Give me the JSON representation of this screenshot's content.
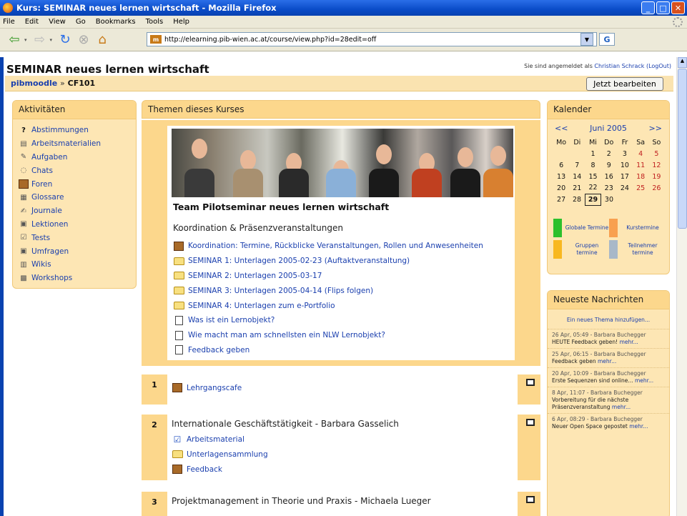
{
  "window": {
    "title": "Kurs: SEMINAR neues lernen wirtschaft - Mozilla Firefox",
    "menu": [
      "File",
      "Edit",
      "View",
      "Go",
      "Bookmarks",
      "Tools",
      "Help"
    ],
    "url": "http://elearning.pib-wien.ac.at/course/view.php?id=28edit=off"
  },
  "page": {
    "course_title": "SEMINAR neues lernen wirtschaft",
    "login_prefix": "Sie sind angemeldet als",
    "login_user": "Christian Schrack",
    "logout": "(LogOut)",
    "breadcrumb_home": "pibmoodle",
    "breadcrumb_sep": "»",
    "breadcrumb_course": "CF101",
    "edit_button": "Jetzt bearbeiten"
  },
  "activities": {
    "header": "Aktivitäten",
    "items": [
      {
        "label": "Abstimmungen",
        "icon": "question-icon"
      },
      {
        "label": "Arbeitsmaterialien",
        "icon": "document-icon"
      },
      {
        "label": "Aufgaben",
        "icon": "assignment-icon"
      },
      {
        "label": "Chats",
        "icon": "chat-icon"
      },
      {
        "label": "Foren",
        "icon": "forum-icon"
      },
      {
        "label": "Glossare",
        "icon": "glossary-icon"
      },
      {
        "label": "Journale",
        "icon": "journal-icon"
      },
      {
        "label": "Lektionen",
        "icon": "lesson-icon"
      },
      {
        "label": "Tests",
        "icon": "quiz-icon"
      },
      {
        "label": "Umfragen",
        "icon": "survey-icon"
      },
      {
        "label": "Wikis",
        "icon": "wiki-icon"
      },
      {
        "label": "Workshops",
        "icon": "workshop-icon"
      }
    ]
  },
  "main": {
    "header": "Themen dieses Kurses",
    "team_title": "Team Pilotseminar neues lernen wirtschaft",
    "section0_subtitle": "Koordination & Präsenzveranstaltungen",
    "section0_items": [
      {
        "label": "Koordination: Termine, Rückblicke Veranstaltungen, Rollen und Anwesenheiten",
        "icon": "forum-icon"
      },
      {
        "label": "SEMINAR 1: Unterlagen 2005-02-23 (Auftaktveranstaltung)",
        "icon": "folder-icon"
      },
      {
        "label": "SEMINAR 2: Unterlagen 2005-03-17",
        "icon": "folder-icon"
      },
      {
        "label": "SEMINAR 3: Unterlagen 2005-04-14 (Flips folgen)",
        "icon": "folder-icon"
      },
      {
        "label": "SEMINAR 4: Unterlagen zum e-Portfolio",
        "icon": "folder-icon"
      },
      {
        "label": "Was ist ein Lernobjekt?",
        "icon": "document-icon"
      },
      {
        "label": "Wie macht man am schnellsten ein NLW Lernobjekt?",
        "icon": "document-icon"
      },
      {
        "label": "Feedback geben",
        "icon": "document-icon"
      }
    ],
    "topics": [
      {
        "num": "1",
        "title": "",
        "items": [
          {
            "label": "Lehrgangscafe",
            "icon": "forum-icon"
          }
        ]
      },
      {
        "num": "2",
        "title": "Internationale Geschäftstätigkeit - Barbara Gasselich",
        "items": [
          {
            "label": "Arbeitsmaterial",
            "icon": "assignment-icon"
          },
          {
            "label": "Unterlagensammlung",
            "icon": "folder-icon"
          },
          {
            "label": "Feedback",
            "icon": "forum-icon"
          }
        ]
      },
      {
        "num": "3",
        "title": "Projektmanagement in Theorie und Praxis - Michaela Lueger",
        "items": []
      }
    ]
  },
  "calendar": {
    "header": "Kalender",
    "prev": "<<",
    "next": ">>",
    "month": "Juni 2005",
    "weekdays": [
      "Mo",
      "Di",
      "Mi",
      "Do",
      "Fr",
      "Sa",
      "So"
    ],
    "weeks": [
      [
        "",
        "",
        "1",
        "2",
        "3",
        "4",
        "5"
      ],
      [
        "6",
        "7",
        "8",
        "9",
        "10",
        "11",
        "12"
      ],
      [
        "13",
        "14",
        "15",
        "16",
        "17",
        "18",
        "19"
      ],
      [
        "20",
        "21",
        "22",
        "23",
        "24",
        "25",
        "26"
      ],
      [
        "27",
        "28",
        "29",
        "30",
        "",
        "",
        ""
      ]
    ],
    "today": "29",
    "legend": [
      {
        "label": "Globale Termine",
        "color": "#2cc02c"
      },
      {
        "label": "Kurstermine",
        "color": "#f8a050"
      },
      {
        "label": "Gruppen termine",
        "color": "#f8b820"
      },
      {
        "label": "Teilnehmer termine",
        "color": "#a8b8c8"
      }
    ]
  },
  "news": {
    "header": "Neueste Nachrichten",
    "add_link": "Ein neues Thema hinzufügen...",
    "more": "mehr...",
    "items": [
      {
        "meta": "26 Apr, 05:49 - Barbara Buchegger",
        "text": "HEUTE Feedback geben!"
      },
      {
        "meta": "25 Apr, 06:15 - Barbara Buchegger",
        "text": "Feedback geben"
      },
      {
        "meta": "20 Apr, 10:09 - Barbara Buchegger",
        "text": "Erste Sequenzen sind online..."
      },
      {
        "meta": "8 Apr, 11:07 - Barbara Buchegger",
        "text": "Vorbereitung für die nächste Präsenzveranstaltung"
      },
      {
        "meta": "6 Apr, 08:29 - Barbara Buchegger",
        "text": "Neuer Open Space gepostet"
      }
    ]
  }
}
